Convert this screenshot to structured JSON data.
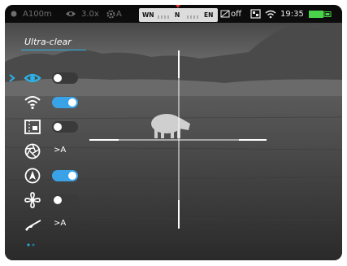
{
  "status_bar": {
    "left_icon": "record-dot-icon",
    "range": "A100m",
    "range_icon": "eye-icon",
    "zoom": "3.0x",
    "focus": "A",
    "focus_icon": "gear-icon",
    "compass": {
      "left": "WN",
      "center": "N",
      "right": "EN",
      "marker_color": "#e03030"
    },
    "pip": "off",
    "pip_icon": "picture-in-picture-off-icon",
    "record_icon": "video-record-icon",
    "wifi_icon": "wifi-icon",
    "time": "19:35",
    "battery_icon": "battery-icon",
    "battery_color": "#4ad34a"
  },
  "menu": {
    "mode_label": "Ultra-clear",
    "accent": "#2ab3e8",
    "items": [
      {
        "icon": "eye-mode-icon",
        "control": "toggle",
        "value": false,
        "selected": true
      },
      {
        "icon": "wifi-icon",
        "control": "toggle",
        "value": true
      },
      {
        "icon": "picture-in-picture-icon",
        "control": "toggle",
        "value": false
      },
      {
        "icon": "aperture-icon",
        "control": "text",
        "value": ">A"
      },
      {
        "icon": "compass-icon",
        "control": "toggle",
        "value": true
      },
      {
        "icon": "fan-icon",
        "control": "toggle",
        "value": false
      },
      {
        "icon": "rifle-icon",
        "control": "text",
        "value": ">A"
      }
    ]
  },
  "page_indicator": {
    "pages": 2,
    "current": 1
  }
}
